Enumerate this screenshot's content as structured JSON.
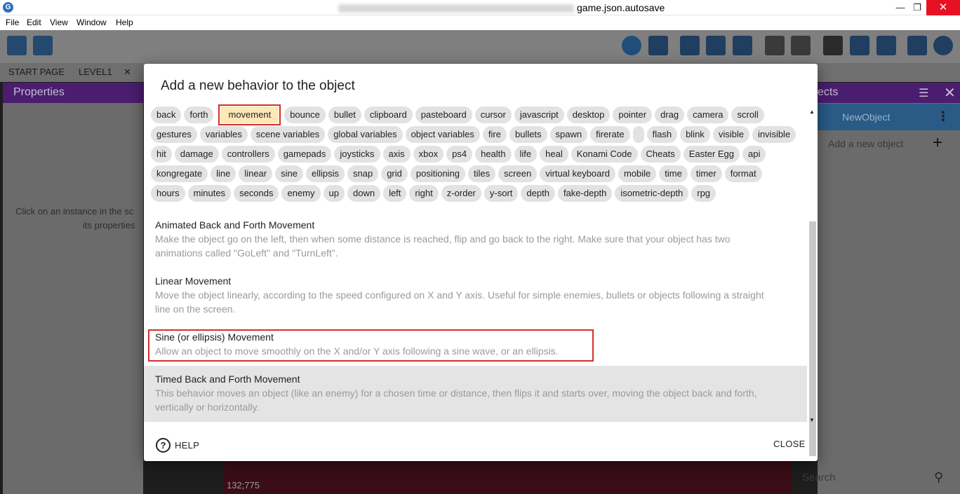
{
  "window": {
    "title_suffix": "game.json.autosave",
    "min_glyph": "—",
    "max_glyph": "❐",
    "close_glyph": "✕",
    "app_icon_glyph": "G"
  },
  "menu": [
    "File",
    "Edit",
    "View",
    "Window",
    "Help"
  ],
  "tabs": {
    "start_page": "START PAGE",
    "level": "LEVEL1",
    "close_glyph": "✕"
  },
  "left_panel": {
    "title": "Properties",
    "hint_line1": "Click on an instance in the sc",
    "hint_line2": "its properties"
  },
  "canvas": {
    "coords": "132;775"
  },
  "right_panel": {
    "title": "ects",
    "object_name": "NewObject",
    "add_object": "Add a new object",
    "search_placeholder": "Search"
  },
  "dialog": {
    "title": "Add a new behavior to the object",
    "chip_rows": [
      [
        "back",
        "forth",
        "movement",
        "bounce",
        "bullet",
        "clipboard",
        "pasteboard",
        "cursor",
        "javascript",
        "desktop",
        "pointer",
        "drag",
        "camera",
        "scroll"
      ],
      [
        "gestures",
        "variables",
        "scene variables",
        "global variables",
        "object variables",
        "fire",
        "bullets",
        "spawn",
        "firerate",
        "",
        "flash",
        "blink",
        "visible",
        "invisible"
      ],
      [
        "hit",
        "damage",
        "controllers",
        "gamepads",
        "joysticks",
        "axis",
        "xbox",
        "ps4",
        "health",
        "life",
        "heal",
        "Konami Code",
        "Cheats",
        "Easter Egg",
        "api"
      ],
      [
        "kongregate",
        "line",
        "linear",
        "sine",
        "ellipsis",
        "snap",
        "grid",
        "positioning",
        "tiles",
        "screen",
        "virtual keyboard",
        "mobile",
        "time",
        "timer",
        "format"
      ],
      [
        "hours",
        "minutes",
        "seconds",
        "enemy",
        "up",
        "down",
        "left",
        "right",
        "z-order",
        "y-sort",
        "depth",
        "fake-depth",
        "isometric-depth",
        "rpg"
      ]
    ],
    "selected_chip": "movement",
    "behaviors": [
      {
        "name": "Animated Back and Forth Movement",
        "description_lines": [
          "Make the object go on the left, then when some distance is reached, flip and go back to the right. Make sure that your object has two",
          "animations called \"GoLeft\" and \"TurnLeft\"."
        ]
      },
      {
        "name": "Linear Movement",
        "description_lines": [
          "Move the object linearly, according to the speed configured on X and Y axis. Useful for simple enemies, bullets or objects following a straight",
          "line on the screen."
        ]
      },
      {
        "name": "Sine (or ellipsis) Movement",
        "description_lines": [
          "Allow an object to move smoothly on the X and/or Y axis following a sine wave, or an ellipsis."
        ]
      },
      {
        "name": "Timed Back and Forth Movement",
        "description_lines": [
          "This behavior moves an object (like an enemy) for a chosen time or distance, then flips it and starts over, moving the object back and forth,",
          "vertically or horizontally."
        ]
      }
    ],
    "help_label": "HELP",
    "help_glyph": "?",
    "close_label": "CLOSE"
  },
  "colors": {
    "panel_header": "#4a1d6f",
    "highlight": "#d32f2f",
    "selected_chip_bg": "#ffe7b8"
  }
}
